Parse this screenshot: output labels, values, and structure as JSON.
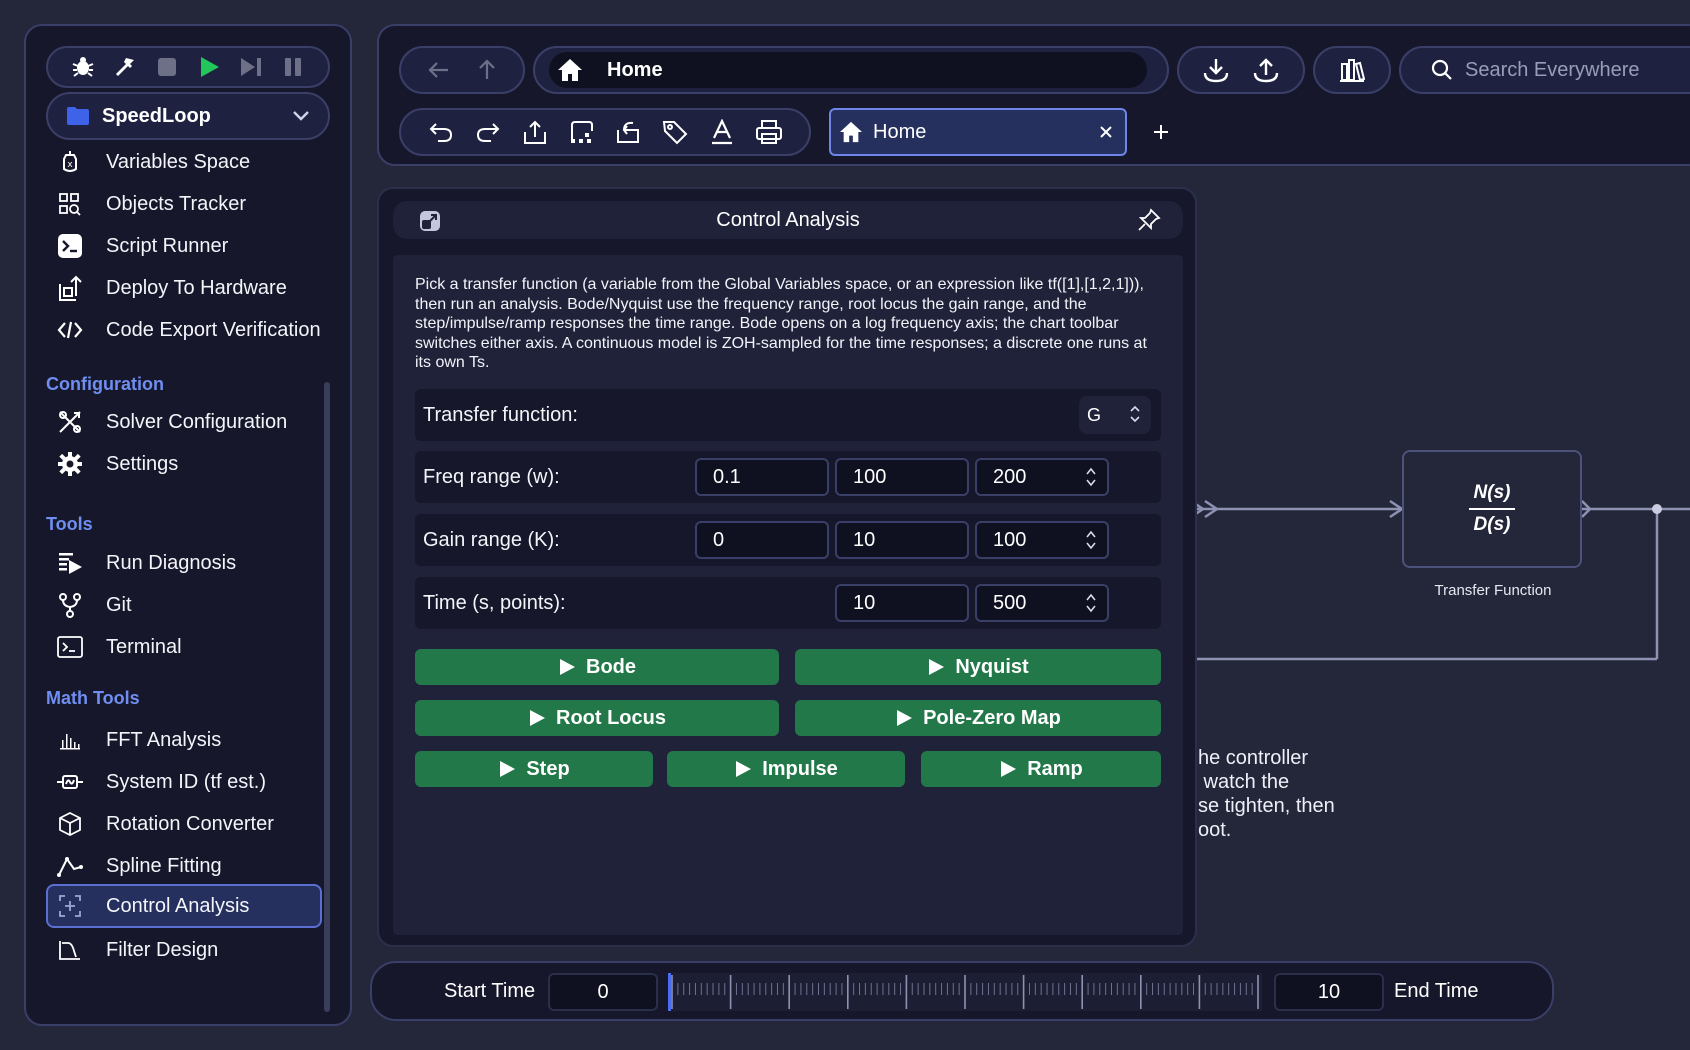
{
  "sidebar": {
    "project": "SpeedLoop",
    "items_top": [
      {
        "label": "Variables Space",
        "icon": "variables-icon"
      },
      {
        "label": "Objects Tracker",
        "icon": "objects-tracker-icon"
      },
      {
        "label": "Script Runner",
        "icon": "script-runner-icon"
      },
      {
        "label": "Deploy To Hardware",
        "icon": "deploy-icon"
      },
      {
        "label": "Code Export Verification",
        "icon": "code-icon"
      }
    ],
    "section_configuration": "Configuration",
    "items_config": [
      {
        "label": "Solver Configuration",
        "icon": "solver-icon"
      },
      {
        "label": "Settings",
        "icon": "gear-icon"
      }
    ],
    "section_tools": "Tools",
    "items_tools": [
      {
        "label": "Run Diagnosis",
        "icon": "diagnosis-icon"
      },
      {
        "label": "Git",
        "icon": "git-icon"
      },
      {
        "label": "Terminal",
        "icon": "terminal-icon"
      }
    ],
    "section_math": "Math Tools",
    "items_math": [
      {
        "label": "FFT Analysis",
        "icon": "fft-icon"
      },
      {
        "label": "System ID (tf est.)",
        "icon": "system-id-icon"
      },
      {
        "label": "Rotation Converter",
        "icon": "cube-icon"
      },
      {
        "label": "Spline Fitting",
        "icon": "spline-icon"
      },
      {
        "label": "Control Analysis",
        "icon": "control-analysis-icon",
        "active": true
      },
      {
        "label": "Filter Design",
        "icon": "filter-icon"
      }
    ]
  },
  "topbar": {
    "address": "Home",
    "search_placeholder": "Search Everywhere",
    "tab_label": "Home"
  },
  "panel": {
    "title": "Control Analysis",
    "description": "Pick a transfer function (a variable from the Global Variables space, or an expression like tf([1],[1,2,1])), then run an analysis. Bode/Nyquist use the frequency range, root locus the gain range, and the step/impulse/ramp responses the time range. Bode opens on a log frequency axis; the chart toolbar switches either axis. A continuous model is ZOH-sampled for the time responses; a discrete one runs at its own Ts.",
    "tf_label": "Transfer function:",
    "tf_value": "G",
    "freq_label": "Freq range (w):",
    "freq": [
      "0.1",
      "100",
      "200"
    ],
    "gain_label": "Gain range (K):",
    "gain": [
      "0",
      "10",
      "100"
    ],
    "time_label": "Time (s, points):",
    "time": [
      "10",
      "500"
    ],
    "buttons": {
      "bode": "Bode",
      "nyquist": "Nyquist",
      "root_locus": "Root Locus",
      "pole_zero": "Pole-Zero Map",
      "step": "Step",
      "impulse": "Impulse",
      "ramp": "Ramp"
    }
  },
  "diagram": {
    "numerator": "N(s)",
    "denominator": "D(s)",
    "block_label": "Transfer Function",
    "text_lines": [
      "he controller",
      " watch the",
      "se tighten, then",
      "oot."
    ]
  },
  "timebar": {
    "start_label": "Start Time",
    "start_value": "0",
    "end_value": "10",
    "end_label": "End Time"
  },
  "colors": {
    "background": "#24263a",
    "panel": "#16172a",
    "accent": "#6f8ef0",
    "button_green": "#23784a",
    "border": "#3a3f68"
  }
}
